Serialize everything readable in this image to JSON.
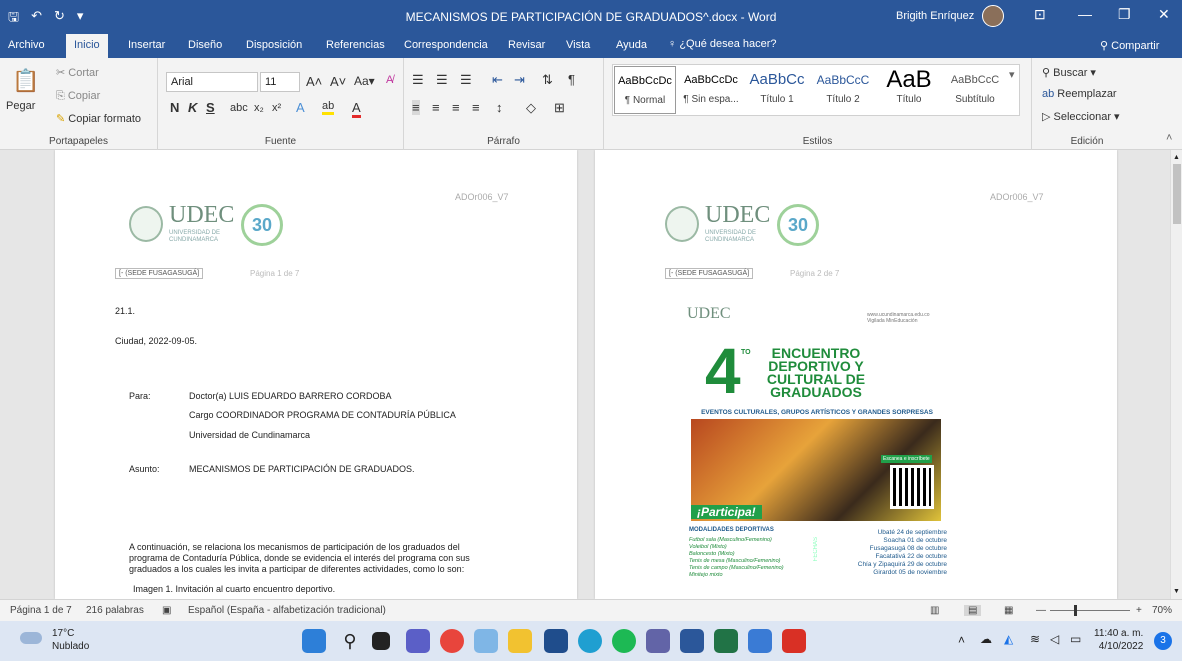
{
  "window": {
    "title": "MECANISMOS DE PARTICIPACIÓN DE GRADUADOS^.docx - Word",
    "user": "Brigith Enríquez"
  },
  "tabs": [
    {
      "label": "Archivo"
    },
    {
      "label": "Inicio",
      "active": true
    },
    {
      "label": "Insertar"
    },
    {
      "label": "Diseño"
    },
    {
      "label": "Disposición"
    },
    {
      "label": "Referencias"
    },
    {
      "label": "Correspondencia"
    },
    {
      "label": "Revisar"
    },
    {
      "label": "Vista"
    },
    {
      "label": "Ayuda"
    }
  ],
  "tell_me": "¿Qué desea hacer?",
  "share": "Compartir",
  "ribbon": {
    "clipboard": {
      "paste": "Pegar",
      "cut": "Cortar",
      "copy": "Copiar",
      "format_painter": "Copiar formato",
      "label": "Portapapeles"
    },
    "font": {
      "name": "Arial",
      "size": "11",
      "label": "Fuente",
      "bold": "N",
      "italic": "K",
      "underline": "S"
    },
    "paragraph": {
      "label": "Párrafo"
    },
    "styles": {
      "label": "Estilos",
      "items": [
        {
          "sample": "AaBbCcDc",
          "name": "¶ Normal"
        },
        {
          "sample": "AaBbCcDc",
          "name": "¶ Sin espa..."
        },
        {
          "sample": "AaBbCc",
          "name": "Título 1"
        },
        {
          "sample": "AaBbCcC",
          "name": "Título 2"
        },
        {
          "sample": "AaB",
          "name": "Título"
        },
        {
          "sample": "AaBbCcC",
          "name": "Subtítulo"
        }
      ]
    },
    "editing": {
      "label": "Edición",
      "find": "Buscar",
      "replace": "Reemplazar",
      "select": "Seleccionar"
    }
  },
  "page1": {
    "ref": "ADOr006_V7",
    "logo": {
      "name": "UDEC",
      "sub": "UNIVERSIDAD DE CUNDINAMARCA",
      "anniversary": "30"
    },
    "sede": "[- (SEDE FUSAGASUGÁ]",
    "page_of": "Página 1 de 7",
    "number": "21.1.",
    "city_date": "Ciudad, 2022-09-05.",
    "para_label": "Para:",
    "recipient_name": "Doctor(a) LUIS EDUARDO BARRERO CORDOBA",
    "recipient_role": "Cargo COORDINADOR PROGRAMA DE CONTADURÍA PÚBLICA",
    "recipient_org": "Universidad de Cundinamarca",
    "subject_label": "Asunto:",
    "subject": "MECANISMOS DE PARTICIPACIÓN DE GRADUADOS.",
    "body_line1": "A continuación, se relaciona los mecanismos de participación de los graduados del",
    "body_line2": "programa de Contaduría Pública, donde se evidencia el interés del programa con sus",
    "body_line3": "graduados a los cuales les invita a participar de diferentes actividades, como lo son:",
    "caption": "Imagen 1. Invitación al cuarto encuentro deportivo."
  },
  "page2": {
    "ref": "ADOr006_V7",
    "sede": "[- (SEDE FUSAGASUGÁ]",
    "page_of": "Página 2 de 7",
    "poster": {
      "logo": "UDEC",
      "web": "www.ucundinamarca.edu.co Vigilada MinEducación",
      "number": "4",
      "ordinal": "TO",
      "headline": "ENCUENTRO DEPORTIVO Y CULTURAL DE GRADUADOS",
      "events": "EVENTOS CULTURALES, GRUPOS ARTÍSTICOS Y GRANDES SORPRESAS",
      "cta": "¡Participa!",
      "qr_label": "Escanea e inscríbete",
      "modal_title": "MODALIDADES DEPORTIVAS",
      "sports": [
        "Futbol sala (Masculino/Femenino)",
        "Voleibol (Mixto)",
        "Baloncesto (Mixto)",
        "Tenis de mesa (Masculino/Femenino)",
        "Tenis de campo (Masculino/Femenino)",
        "Minitejo mixto"
      ],
      "fechas": "FECHAS",
      "dates": [
        "Ubaté 24 de septiembre",
        "Soacha 01 de octubre",
        "Fusagasugá 08 de octubre",
        "Facatativá 22 de octubre",
        "Chía y Zipaquirá 29 de octubre",
        "Girardot 05 de noviembre"
      ]
    }
  },
  "status": {
    "page": "Página 1 de 7",
    "words": "216 palabras",
    "language": "Español (España - alfabetización tradicional)",
    "zoom": "70%"
  },
  "taskbar": {
    "temp": "17°C",
    "weather": "Nublado",
    "time": "11:40 a. m.",
    "date": "4/10/2022",
    "notifications": "3"
  }
}
